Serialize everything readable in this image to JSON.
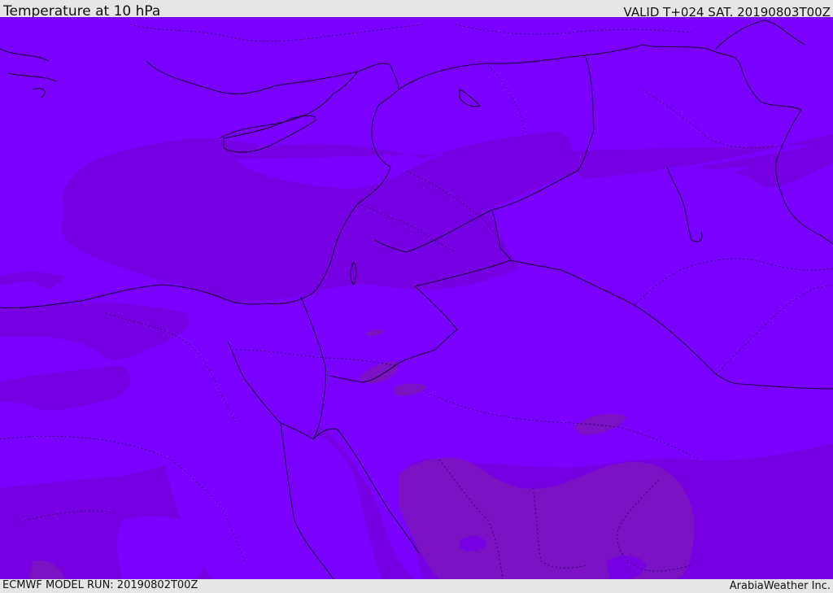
{
  "header": {
    "title": "Temperature at 10 hPa",
    "valid_time": "VALID T+024 SAT. 20190803T00Z"
  },
  "footer": {
    "model_run": "ECMWF MODEL RUN: 20190802T00Z",
    "credit": "ArabiaWeather Inc."
  },
  "map": {
    "field_colors": {
      "light_band": "#7a00ff",
      "mid_band": "#7600e2",
      "warm_band": "#7a12c4"
    },
    "coastline_color": "#1a0040",
    "border_style": "dotted"
  }
}
